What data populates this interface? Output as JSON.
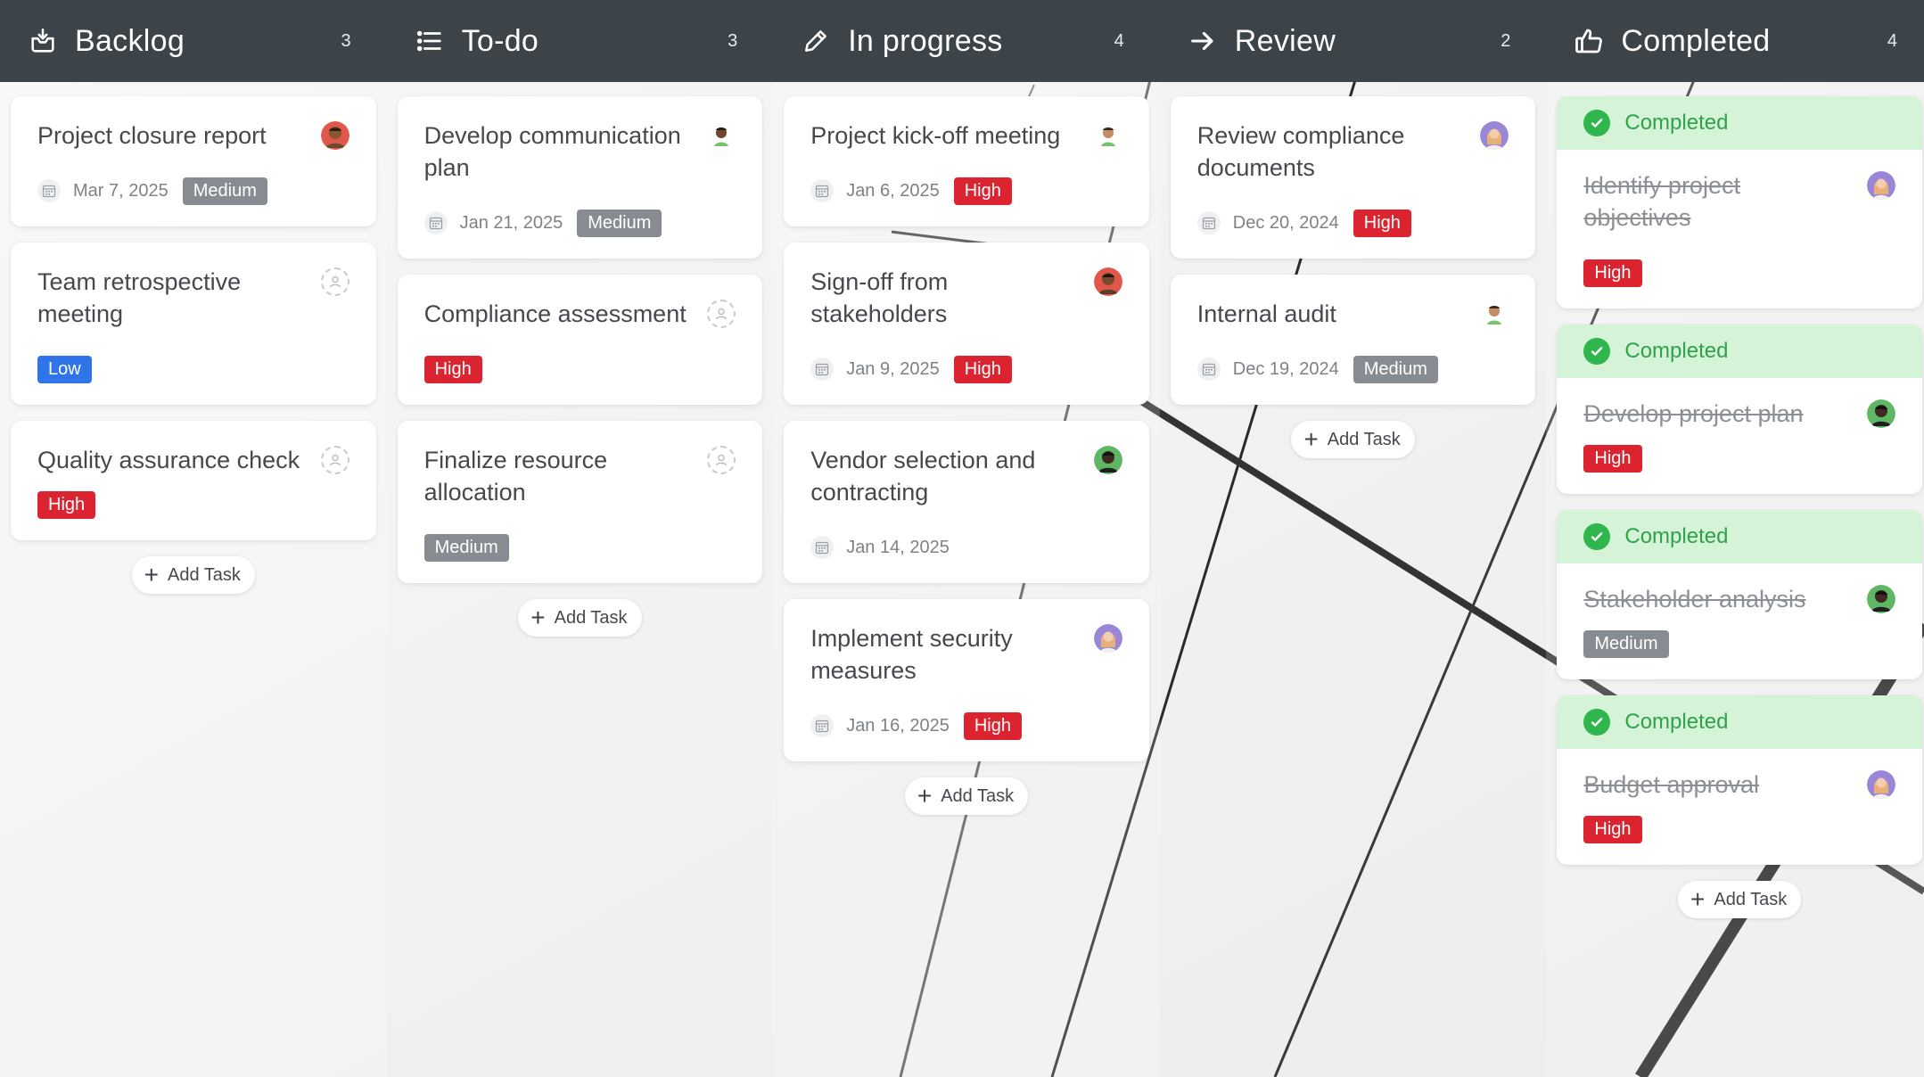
{
  "columns": [
    {
      "key": "backlog",
      "title": "Backlog",
      "count": "3",
      "icon": "inbox-download-icon",
      "add_label": "Add Task",
      "cards": [
        {
          "title": "Project closure report",
          "due": "Mar 7, 2025",
          "priority": "Medium",
          "avatar": "avatar-man-red"
        },
        {
          "title": "Team retrospective meeting",
          "due": "",
          "priority": "Low",
          "avatar": "none"
        },
        {
          "title": "Quality assurance check",
          "due": "",
          "priority": "High",
          "avatar": "none"
        }
      ]
    },
    {
      "key": "todo",
      "title": "To-do",
      "count": "3",
      "icon": "list-icon",
      "add_label": "Add Task",
      "cards": [
        {
          "title": "Develop communication plan",
          "due": "Jan 21, 2025",
          "priority": "Medium",
          "avatar": "avatar-man-green"
        },
        {
          "title": "Compliance assessment",
          "due": "",
          "priority": "High",
          "avatar": "none"
        },
        {
          "title": "Finalize resource allocation",
          "due": "",
          "priority": "Medium",
          "avatar": "none"
        }
      ]
    },
    {
      "key": "inprogress",
      "title": "In progress",
      "count": "4",
      "icon": "pencil-icon",
      "add_label": "Add Task",
      "cards": [
        {
          "title": "Project kick-off meeting",
          "due": "Jan 6, 2025",
          "priority": "High",
          "avatar": "avatar-man-green"
        },
        {
          "title": "Sign-off from stakeholders",
          "due": "Jan 9, 2025",
          "priority": "High",
          "avatar": "avatar-man-red"
        },
        {
          "title": "Vendor selection and contracting",
          "due": "Jan 14, 2025",
          "priority": "",
          "avatar": "avatar-man-dark"
        },
        {
          "title": "Implement security measures",
          "due": "Jan 16, 2025",
          "priority": "High",
          "avatar": "avatar-woman-purple"
        }
      ]
    },
    {
      "key": "review",
      "title": "Review",
      "count": "2",
      "icon": "arrow-right-icon",
      "add_label": "Add Task",
      "cards": [
        {
          "title": "Review compliance documents",
          "due": "Dec 20, 2024",
          "priority": "High",
          "avatar": "avatar-woman-purple"
        },
        {
          "title": "Internal audit",
          "due": "Dec 19, 2024",
          "priority": "Medium",
          "avatar": "avatar-man-green"
        }
      ]
    },
    {
      "key": "completed",
      "title": "Completed",
      "count": "4",
      "icon": "thumbs-up-icon",
      "add_label": "Add Task",
      "status_label": "Completed",
      "cards": [
        {
          "title": "Identify project objectives",
          "due": "",
          "priority": "High",
          "avatar": "avatar-woman-purple"
        },
        {
          "title": "Develop project plan",
          "due": "",
          "priority": "High",
          "avatar": "avatar-man-dark"
        },
        {
          "title": "Stakeholder analysis",
          "due": "",
          "priority": "Medium",
          "avatar": "avatar-man-dark"
        },
        {
          "title": "Budget approval",
          "due": "",
          "priority": "High",
          "avatar": "avatar-woman-purple"
        }
      ]
    }
  ],
  "colors": {
    "header_bg": "#3c4349",
    "high": "#dc2430",
    "medium": "#868c91",
    "low": "#2f74e8",
    "completed_bg": "#d4f3d7",
    "completed_text": "#2fa24b"
  }
}
